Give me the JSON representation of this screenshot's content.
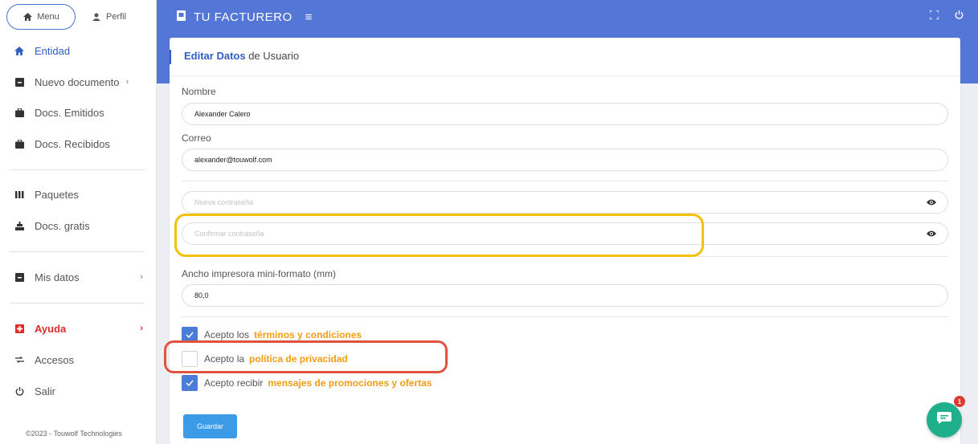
{
  "sidebar": {
    "menu_label": "Menu",
    "perfil_label": "Perfil",
    "items": [
      {
        "label": "Entidad",
        "icon": "home-icon"
      },
      {
        "label": "Nuevo documento",
        "icon": "document-add-icon",
        "chevron": "›"
      },
      {
        "label": "Docs. Emitidos",
        "icon": "briefcase-icon"
      },
      {
        "label": "Docs. Recibidos",
        "icon": "briefcase-icon"
      },
      {
        "label": "Paquetes",
        "icon": "bars-icon"
      },
      {
        "label": "Docs. gratis",
        "icon": "gift-icon"
      },
      {
        "label": "Mis datos",
        "icon": "user-data-icon",
        "chevron": "›"
      },
      {
        "label": "Ayuda",
        "icon": "help-icon",
        "chevron": "›"
      },
      {
        "label": "Accesos",
        "icon": "key-icon"
      },
      {
        "label": "Salir",
        "icon": "power-icon"
      }
    ],
    "footer": "©2023 - Touwolf Technologies"
  },
  "header": {
    "brand": "TU FACTURERO",
    "hamburger": "≡"
  },
  "card": {
    "title_bold": "Editar Datos",
    "title_rest": " de Usuario",
    "nombre_label": "Nombre",
    "nombre_value": "Alexander Calero",
    "correo_label": "Correo",
    "correo_value": "alexander@touwolf.com",
    "password_placeholder": "Nueva contraseña",
    "confirm_placeholder": "Confirmar contraseña",
    "ancho_label": "Ancho impresora mini-formato (mm)",
    "ancho_value": "80,0",
    "terms_prefix": "Acepto los",
    "terms_link": "términos y condiciones",
    "terms_checked": true,
    "privacy_prefix": "Acepto la",
    "privacy_link": "política de privacidad",
    "privacy_checked": false,
    "promo_prefix": "Acepto recibir",
    "promo_link": "mensajes de promociones y ofertas",
    "promo_checked": true,
    "save_label": "Guardar"
  },
  "chat": {
    "badge": "1"
  },
  "colors": {
    "accent": "#5476d6",
    "link": "#f39c12",
    "help": "#e02b2b",
    "highlight_yellow": "#f3c108",
    "highlight_red": "#e0533f",
    "chat": "#1fb08b"
  }
}
